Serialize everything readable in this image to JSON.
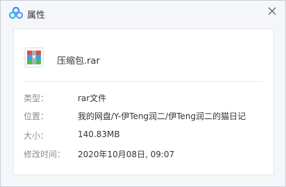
{
  "window": {
    "title": "属性"
  },
  "file": {
    "name": "压缩包.rar",
    "icon": "rar-archive-icon"
  },
  "properties": [
    {
      "key": "类型：",
      "value": "rar文件"
    },
    {
      "key": "位置：",
      "value": "我的网盘/Y-伊Teng润二/伊Teng润二的猫日记"
    },
    {
      "key": "大小：",
      "value": "140.83MB"
    },
    {
      "key": "修改时间：",
      "value": "2020年10月08日, 09:07"
    }
  ],
  "colors": {
    "brand": "#3b8cf3",
    "label": "#888c94"
  }
}
